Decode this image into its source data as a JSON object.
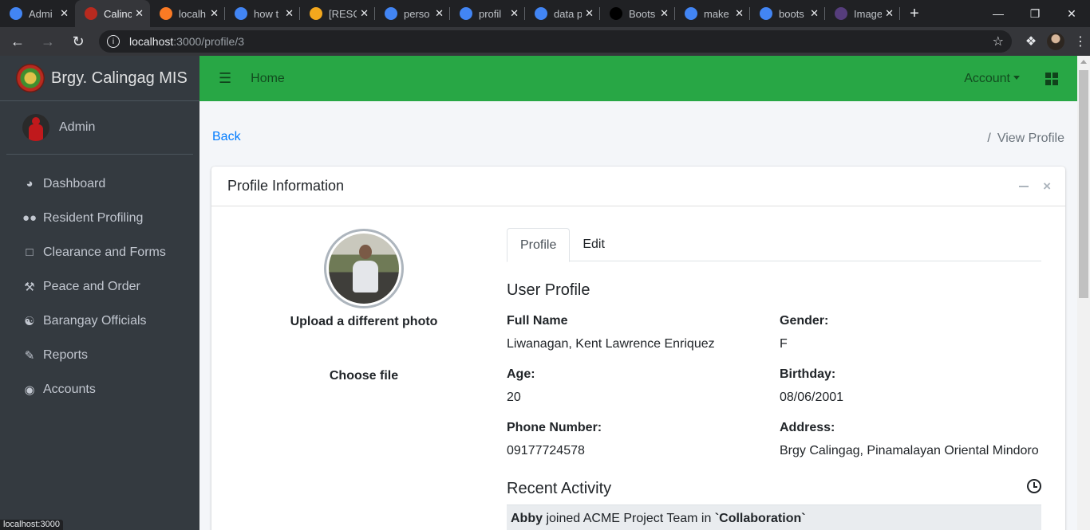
{
  "browser": {
    "tabs": [
      {
        "title": "Admi",
        "favicon": "chrome-icon",
        "color": "#4285f4"
      },
      {
        "title": "Calinc",
        "favicon": "calingag-logo-icon",
        "color": "#b82a1f",
        "active": true
      },
      {
        "title": "localh",
        "favicon": "xampp-icon",
        "color": "#fb7a24"
      },
      {
        "title": "how t",
        "favicon": "google-icon",
        "color": "#4285f4"
      },
      {
        "title": "[RESC",
        "favicon": "stackoverflow-icon",
        "color": "#f4a81d"
      },
      {
        "title": "perso",
        "favicon": "google-icon",
        "color": "#4285f4"
      },
      {
        "title": "profil",
        "favicon": "google-icon",
        "color": "#4285f4"
      },
      {
        "title": "data p",
        "favicon": "google-icon",
        "color": "#4285f4"
      },
      {
        "title": "Boots",
        "favicon": "codeply-icon",
        "color": "#000000"
      },
      {
        "title": "make",
        "favicon": "google-icon",
        "color": "#4285f4"
      },
      {
        "title": "boots",
        "favicon": "google-icon",
        "color": "#4285f4"
      },
      {
        "title": "Image",
        "favicon": "bootstrap-icon",
        "color": "#563d7c"
      }
    ],
    "url_host": "localhost",
    "url_path": ":3000/profile/3",
    "status_url": "localhost:3000"
  },
  "sidebar": {
    "brand": "Brgy. Calingag MIS",
    "user": "Admin",
    "items": [
      {
        "label": "Dashboard",
        "icon": "tachometer-icon"
      },
      {
        "label": "Resident Profiling",
        "icon": "users-icon"
      },
      {
        "label": "Clearance and Forms",
        "icon": "file-icon"
      },
      {
        "label": "Peace and Order",
        "icon": "gavel-icon"
      },
      {
        "label": "Barangay Officials",
        "icon": "landmark-icon"
      },
      {
        "label": "Reports",
        "icon": "file-signature-icon"
      },
      {
        "label": "Accounts",
        "icon": "user-circle-icon"
      }
    ]
  },
  "topnav": {
    "home": "Home",
    "account": "Account",
    "color": "#28a745"
  },
  "page": {
    "back": "Back",
    "breadcrumb": "View Profile"
  },
  "card": {
    "title": "Profile Information",
    "upload_label": "Upload a different photo",
    "choose_file": "Choose file",
    "tabs": [
      "Profile",
      "Edit"
    ],
    "section_title": "User Profile",
    "fields": {
      "full_name_label": "Full Name",
      "full_name": "Liwanagan, Kent Lawrence Enriquez",
      "gender_label": "Gender:",
      "gender": "F",
      "age_label": "Age:",
      "age": "20",
      "birthday_label": "Birthday:",
      "birthday": "08/06/2001",
      "phone_label": "Phone Number:",
      "phone": "09177724578",
      "address_label": "Address:",
      "address": "Brgy Calingag, Pinamalayan Oriental Mindoro"
    },
    "recent_activity_title": "Recent Activity",
    "activity": {
      "user": "Abby",
      "text": " joined ACME Project Team in ",
      "project": "`Collaboration`"
    }
  }
}
